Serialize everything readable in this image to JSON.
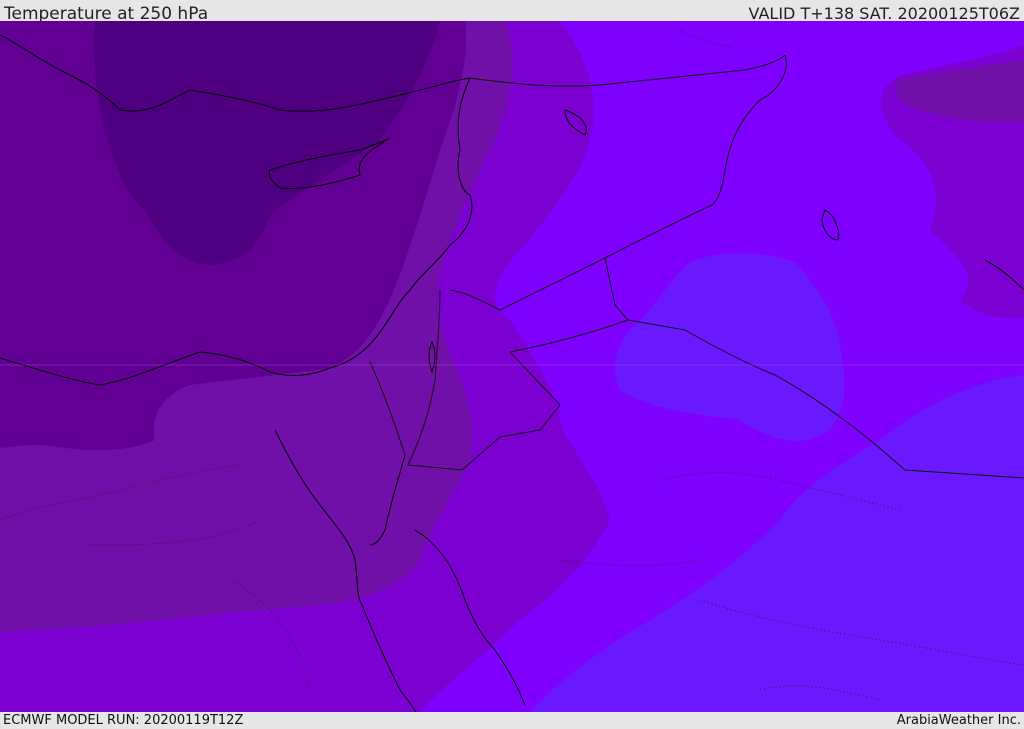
{
  "header": {
    "title": "Temperature at 250 hPa",
    "valid": "VALID T+138 SAT. 20200125T06Z"
  },
  "footer": {
    "model_run": "ECMWF MODEL RUN: 20200119T12Z",
    "brand": "ArabiaWeather Inc."
  },
  "map": {
    "variable": "temperature",
    "level": "250 hPa",
    "colors": {
      "band_darkest": "#4e0080",
      "band_dark": "#610093",
      "band_mid": "#7110a8",
      "band_violet": "#7d00d2",
      "band_bright": "#8000ff",
      "band_blue": "#6a18ff",
      "coastline": "#000000"
    }
  }
}
